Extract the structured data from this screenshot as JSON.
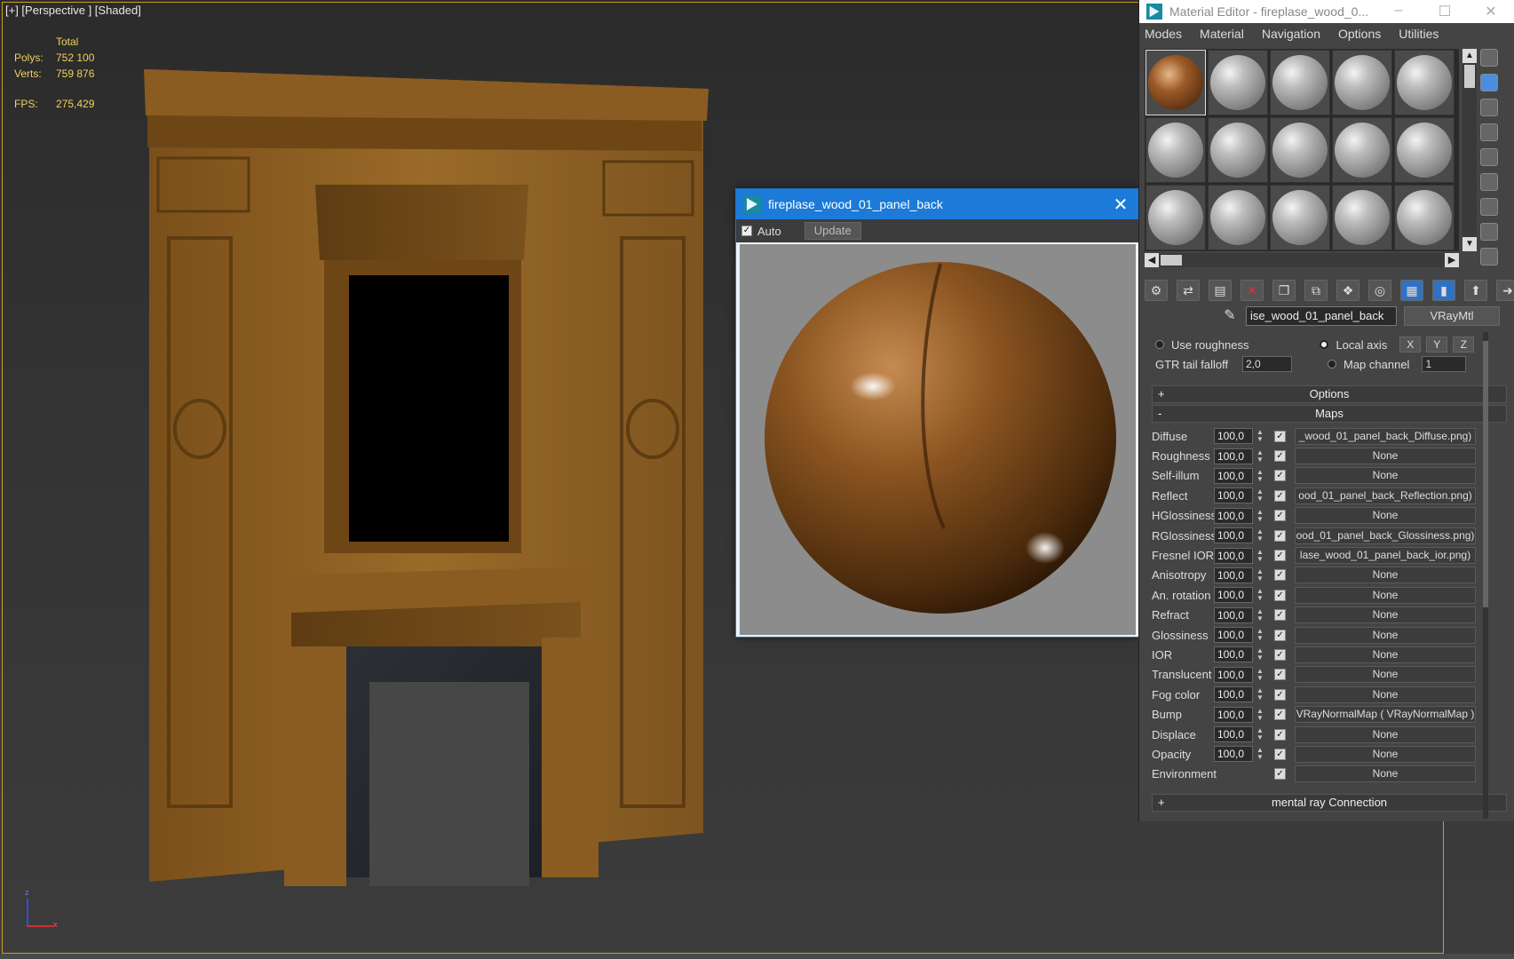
{
  "viewport": {
    "label": "[+] [Perspective ] [Shaded]",
    "stats": {
      "total_label": "Total",
      "polys_label": "Polys:",
      "polys_value": "752 100",
      "verts_label": "Verts:",
      "verts_value": "759 876",
      "fps_label": "FPS:",
      "fps_value": "275,429"
    },
    "axis": {
      "z": "z",
      "x": "x"
    }
  },
  "render_window": {
    "title": "fireplase_wood_01_panel_back",
    "close": "✕",
    "auto_label": "Auto",
    "auto_checked": "✓",
    "update_label": "Update"
  },
  "material_editor": {
    "title": "Material Editor - fireplase_wood_0...",
    "window_controls": [
      "–",
      "☐",
      "✕"
    ],
    "menu": [
      "Modes",
      "Material",
      "Navigation",
      "Options",
      "Utilities"
    ],
    "material_name": "ise_wood_01_panel_back",
    "material_type": "VRayMtl",
    "use_roughness": "Use roughness",
    "local_axis": "Local axis",
    "axes": [
      "X",
      "Y",
      "Z"
    ],
    "gtr_label": "GTR tail falloff",
    "gtr_value": "2,0",
    "map_channel_label": "Map channel",
    "map_channel_value": "1",
    "options_rollout": {
      "sign": "+",
      "label": "Options"
    },
    "maps_rollout": {
      "sign": "-",
      "label": "Maps"
    },
    "maps": [
      {
        "label": "Diffuse",
        "amount": "100,0",
        "map": "_wood_01_panel_back_Diffuse.png)"
      },
      {
        "label": "Roughness",
        "amount": "100,0",
        "map": "None"
      },
      {
        "label": "Self-illum",
        "amount": "100,0",
        "map": "None"
      },
      {
        "label": "Reflect",
        "amount": "100,0",
        "map": "ood_01_panel_back_Reflection.png)"
      },
      {
        "label": "HGlossiness",
        "amount": "100,0",
        "map": "None"
      },
      {
        "label": "RGlossiness",
        "amount": "100,0",
        "map": "ood_01_panel_back_Glossiness.png)"
      },
      {
        "label": "Fresnel IOR",
        "amount": "100,0",
        "map": "lase_wood_01_panel_back_ior.png)"
      },
      {
        "label": "Anisotropy",
        "amount": "100,0",
        "map": "None"
      },
      {
        "label": "An. rotation",
        "amount": "100,0",
        "map": "None"
      },
      {
        "label": "Refract",
        "amount": "100,0",
        "map": "None"
      },
      {
        "label": "Glossiness",
        "amount": "100,0",
        "map": "None"
      },
      {
        "label": "IOR",
        "amount": "100,0",
        "map": "None"
      },
      {
        "label": "Translucent",
        "amount": "100,0",
        "map": "None"
      },
      {
        "label": "Fog color",
        "amount": "100,0",
        "map": "None"
      },
      {
        "label": "Bump",
        "amount": "100,0",
        "map": "VRayNormalMap  ( VRayNormalMap )"
      },
      {
        "label": "Displace",
        "amount": "100,0",
        "map": "None"
      },
      {
        "label": "Opacity",
        "amount": "100,0",
        "map": "None"
      },
      {
        "label": "Environment",
        "amount": "",
        "map": "None"
      }
    ],
    "mental_ray_rollout": {
      "sign": "+",
      "label": "mental ray Connection"
    }
  }
}
